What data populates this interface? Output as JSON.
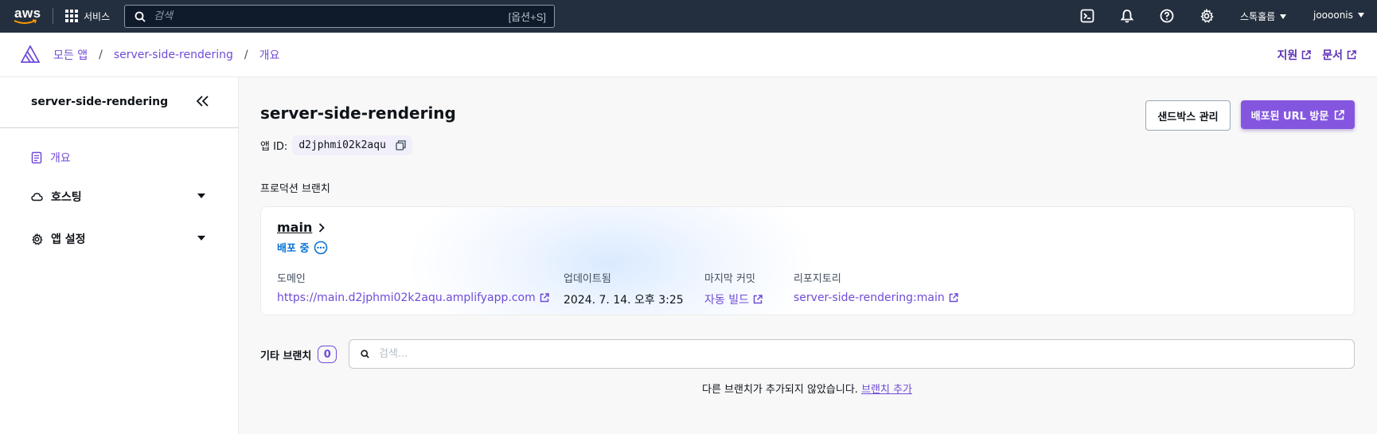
{
  "topnav": {
    "logo_text": "aws",
    "services_label": "서비스",
    "search_placeholder": "검색",
    "search_shortcut": "[옵션+S]",
    "region_label": "스톡홀름",
    "account_label": "joooonis",
    "icons": [
      "cloudshell-icon",
      "notifications-icon",
      "help-icon",
      "settings-icon"
    ]
  },
  "breadcrumb": {
    "items": [
      "모든 앱",
      "server-side-rendering",
      "개요"
    ],
    "separator": "/"
  },
  "top_links": {
    "support": "지원",
    "docs": "문서"
  },
  "sidebar": {
    "title": "server-side-rendering",
    "items": [
      {
        "label": "개요",
        "icon": "document-icon",
        "active": true
      },
      {
        "label": "호스팅",
        "icon": "cloud-icon",
        "expandable": true
      },
      {
        "label": "앱 설정",
        "icon": "settings-icon",
        "expandable": true
      }
    ]
  },
  "main": {
    "title": "server-side-rendering",
    "app_id_label": "앱 ID:",
    "app_id_value": "d2jphmi02k2aqu",
    "manage_sandbox_label": "샌드박스 관리",
    "visit_url_label": "배포된 URL 방문",
    "production_branch_label": "프로덕션 브랜치",
    "branch": {
      "name": "main",
      "status": "배포 중",
      "domain_label": "도메인",
      "domain_value": "https://main.d2jphmi02k2aqu.amplifyapp.com",
      "updated_label": "업데이트됨",
      "updated_value": "2024. 7. 14. 오후 3:25",
      "last_commit_label": "마지막 커밋",
      "last_commit_value": "자동 빌드",
      "repository_label": "리포지토리",
      "repository_value": "server-side-rendering:main"
    },
    "other_branches_label": "기타 브랜치",
    "other_branches_count": "0",
    "filter_placeholder": "검색...",
    "empty_message": "다른 브랜치가 추가되지 않았습니다.",
    "add_branch_label": "브랜치 추가"
  },
  "colors": {
    "nav_bg": "#232f3e",
    "accent": "#6f4bd8",
    "primary_button": "#8456e0",
    "status_blue": "#0972d3"
  }
}
